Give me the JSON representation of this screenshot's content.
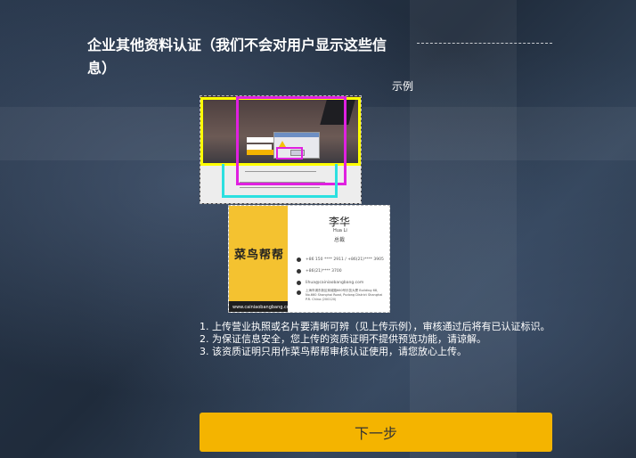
{
  "section": {
    "title": "企业其他资料认证（我们不会对用户显示这些信息）",
    "example_label": "示例"
  },
  "card": {
    "logo": "菜鸟帮帮",
    "name": "李华",
    "pinyin": "Hua Li",
    "role": "总裁",
    "phone": "+86 150 **** 2911  /  +86(21)**** 3905",
    "fax": "+86(21)**** 3700",
    "email": "lihua@cainiaobangbang.com",
    "address": "上海市浦东新区商城路660号乐凯大厦 Building 68, No.660 Shanghai Road, Pudong District Shanghai P.R. China (200120)",
    "website": "www.cainiaobangbang.com"
  },
  "notes": [
    "1. 上传营业执照或名片要清晰可辨（见上传示例），审核通过后将有已认证标识。",
    "2. 为保证信息安全，您上传的资质证明不提供预览功能，请谅解。",
    "3. 该资质证明只用作菜鸟帮帮审核认证使用，请您放心上传。"
  ],
  "buttons": {
    "next": "下一步"
  },
  "colors": {
    "accent": "#f4b400",
    "highlight_yellow": "#ffff00",
    "highlight_magenta": "#e020e0",
    "highlight_cyan": "#2ce0e0"
  }
}
